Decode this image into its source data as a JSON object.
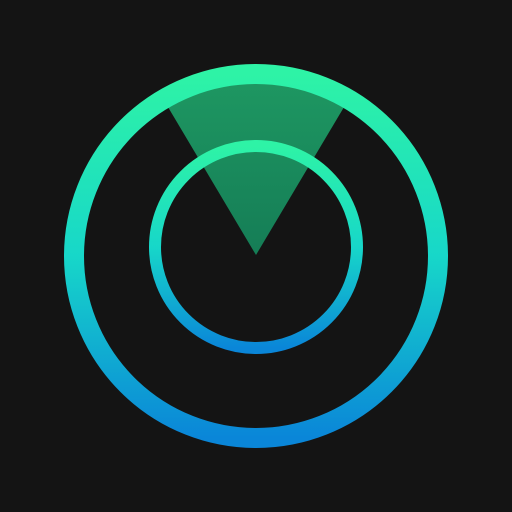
{
  "icon": {
    "name": "radar-scanner-icon",
    "colors": {
      "background": "#141414",
      "ring_gradient_top": "#2ef3a6",
      "ring_gradient_mid": "#17d7c9",
      "ring_gradient_bottom": "#0a86d8",
      "sweep_top": "#1f9a63",
      "sweep_bottom": "#157d56"
    }
  }
}
